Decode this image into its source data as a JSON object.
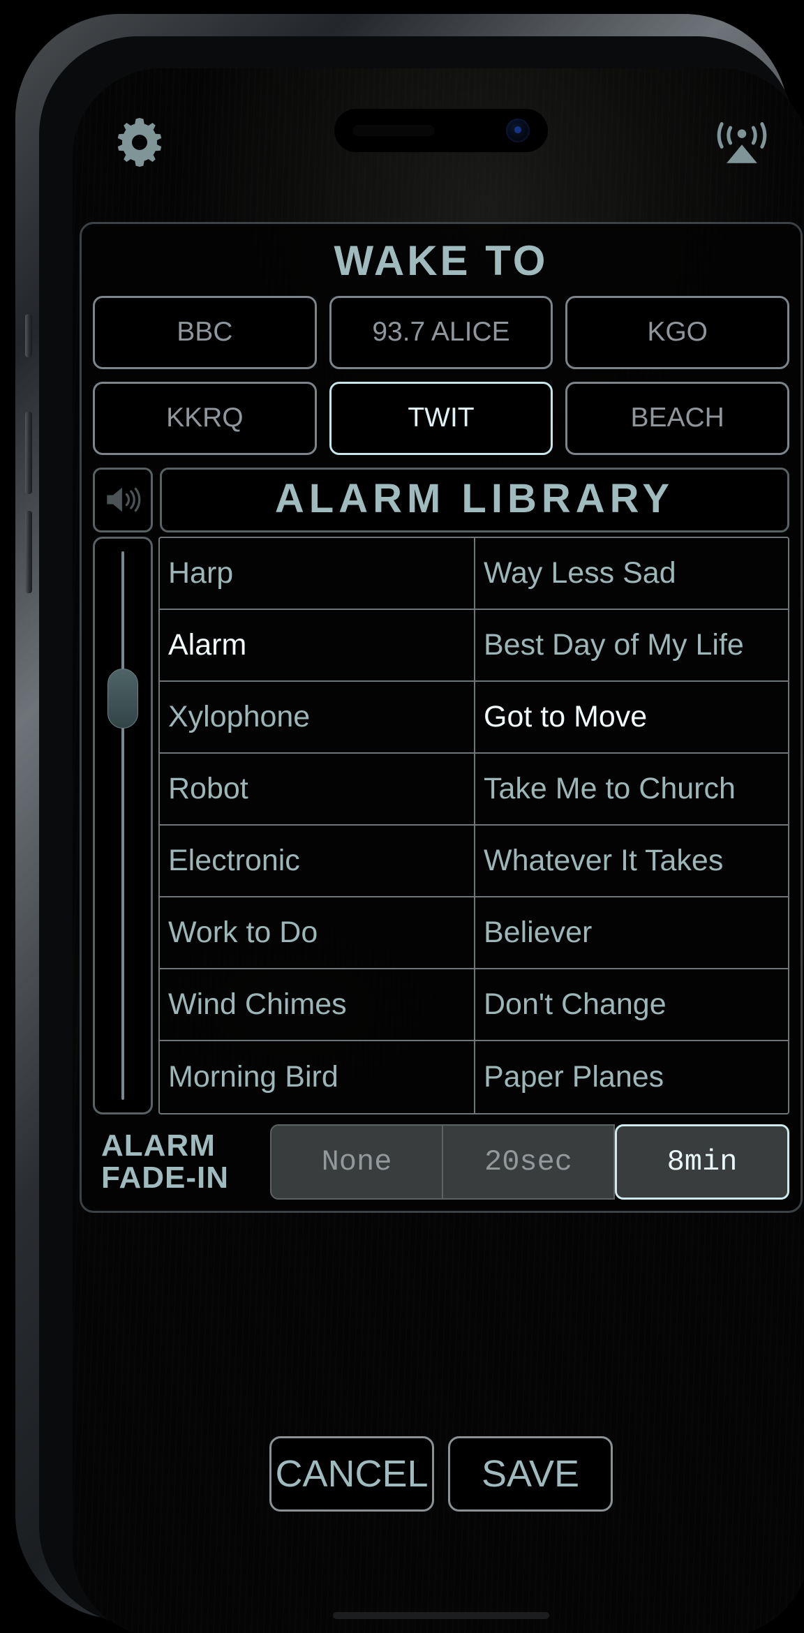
{
  "app": {
    "panel_title": "WAKE TO",
    "library_title": "ALARM    LIBRARY",
    "accent_color": "#9fbbbe",
    "selected_color": "#dff2f5",
    "muted_color": "#8f979c"
  },
  "topbar": {
    "settings_icon": "gear-icon",
    "airplay_icon": "airplay-icon"
  },
  "stations": [
    {
      "label": "BBC",
      "selected": false
    },
    {
      "label": "93.7 ALICE",
      "selected": false
    },
    {
      "label": "KGO",
      "selected": false
    },
    {
      "label": "KKRQ",
      "selected": false
    },
    {
      "label": "TWIT",
      "selected": true
    },
    {
      "label": "BEACH",
      "selected": false
    }
  ],
  "library": {
    "speaker_icon": "speaker-icon",
    "volume_slider": {
      "name": "volume-slider",
      "thumb_position_pct": 30
    },
    "alarms": [
      {
        "label": "Harp",
        "selected": false
      },
      {
        "label": "Alarm",
        "selected": true
      },
      {
        "label": "Xylophone",
        "selected": false
      },
      {
        "label": "Robot",
        "selected": false
      },
      {
        "label": "Electronic",
        "selected": false
      },
      {
        "label": "Work to Do",
        "selected": false
      },
      {
        "label": "Wind Chimes",
        "selected": false
      },
      {
        "label": "Morning Bird",
        "selected": false
      }
    ],
    "songs": [
      {
        "label": "Way Less Sad",
        "selected": false
      },
      {
        "label": "Best Day of My Life",
        "selected": false
      },
      {
        "label": "Got to Move",
        "selected": true
      },
      {
        "label": "Take Me to Church",
        "selected": false
      },
      {
        "label": "Whatever It Takes",
        "selected": false
      },
      {
        "label": "Believer",
        "selected": false
      },
      {
        "label": "Don't Change",
        "selected": false
      },
      {
        "label": "Paper Planes",
        "selected": false
      }
    ]
  },
  "fade_in": {
    "label_line1": "ALARM",
    "label_line2": "FADE-IN",
    "options": [
      {
        "label": "None",
        "selected": false
      },
      {
        "label": "20sec",
        "selected": false
      },
      {
        "label": "8min",
        "selected": true
      }
    ]
  },
  "footer": {
    "cancel_label": "CANCEL",
    "save_label": "SAVE"
  }
}
